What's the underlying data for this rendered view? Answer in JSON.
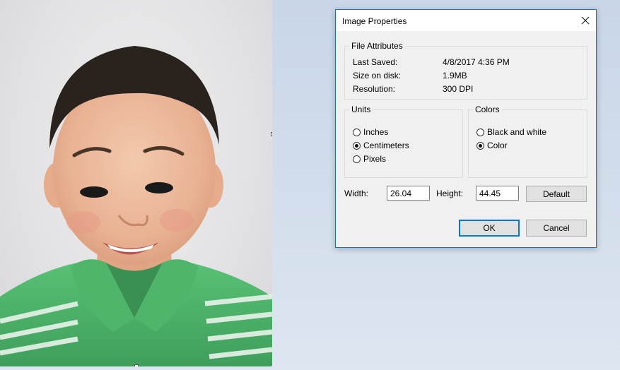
{
  "dialog": {
    "title": "Image Properties",
    "file_attributes": {
      "legend": "File Attributes",
      "rows": [
        {
          "label": "Last Saved:",
          "value": "4/8/2017 4:36 PM"
        },
        {
          "label": "Size on disk:",
          "value": "1.9MB"
        },
        {
          "label": "Resolution:",
          "value": "300 DPI"
        }
      ]
    },
    "units": {
      "legend": "Units",
      "options": [
        {
          "label": "Inches",
          "selected": false
        },
        {
          "label": "Centimeters",
          "selected": true
        },
        {
          "label": "Pixels",
          "selected": false
        }
      ]
    },
    "colors": {
      "legend": "Colors",
      "options": [
        {
          "label": "Black and white",
          "selected": false
        },
        {
          "label": "Color",
          "selected": true
        }
      ]
    },
    "width_label": "Width:",
    "width_value": "26.04",
    "height_label": "Height:",
    "height_value": "44.45",
    "default_label": "Default",
    "ok_label": "OK",
    "cancel_label": "Cancel"
  },
  "colors_theme": {
    "accent": "#0078d7",
    "dialog_border": "#1f6fb5",
    "shirt_green": "#4db56a"
  }
}
